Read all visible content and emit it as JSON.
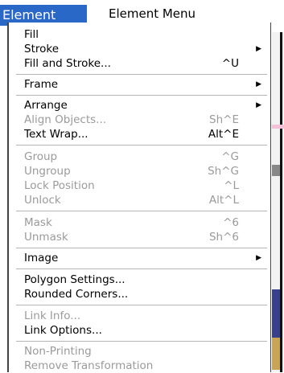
{
  "menubar": {
    "active_tab": "Element",
    "menu_title": "Element Menu"
  },
  "menu": {
    "items": [
      {
        "label": "Fill",
        "shortcut": "",
        "submenu": false,
        "enabled": true
      },
      {
        "label": "Stroke",
        "shortcut": "",
        "submenu": true,
        "enabled": true
      },
      {
        "label": "Fill and Stroke...",
        "shortcut": "^U",
        "submenu": false,
        "enabled": true
      },
      {
        "label": "Frame",
        "shortcut": "",
        "submenu": true,
        "enabled": true
      },
      {
        "label": "Arrange",
        "shortcut": "",
        "submenu": true,
        "enabled": true
      },
      {
        "label": "Align Objects...",
        "shortcut": "Sh^E",
        "submenu": false,
        "enabled": false
      },
      {
        "label": "Text Wrap...",
        "shortcut": "Alt^E",
        "submenu": false,
        "enabled": true
      },
      {
        "label": "Group",
        "shortcut": "^G",
        "submenu": false,
        "enabled": false
      },
      {
        "label": "Ungroup",
        "shortcut": "Sh^G",
        "submenu": false,
        "enabled": false
      },
      {
        "label": "Lock Position",
        "shortcut": "^L",
        "submenu": false,
        "enabled": false
      },
      {
        "label": "Unlock",
        "shortcut": "Alt^L",
        "submenu": false,
        "enabled": false
      },
      {
        "label": "Mask",
        "shortcut": "^6",
        "submenu": false,
        "enabled": false
      },
      {
        "label": "Unmask",
        "shortcut": "Sh^6",
        "submenu": false,
        "enabled": false
      },
      {
        "label": "Image",
        "shortcut": "",
        "submenu": true,
        "enabled": true
      },
      {
        "label": "Polygon Settings...",
        "shortcut": "",
        "submenu": false,
        "enabled": true
      },
      {
        "label": "Rounded Corners...",
        "shortcut": "",
        "submenu": false,
        "enabled": true
      },
      {
        "label": "Link Info...",
        "shortcut": "",
        "submenu": false,
        "enabled": false
      },
      {
        "label": "Link Options...",
        "shortcut": "",
        "submenu": false,
        "enabled": true
      },
      {
        "label": "Non-Printing",
        "shortcut": "",
        "submenu": false,
        "enabled": false
      },
      {
        "label": "Remove Transformation",
        "shortcut": "",
        "submenu": false,
        "enabled": false
      }
    ]
  },
  "colors": {
    "tab_background": "#2a68c8",
    "disabled_text": "#9a9a9a"
  },
  "icons": {
    "submenu_indicator": "triangle-right-icon"
  }
}
